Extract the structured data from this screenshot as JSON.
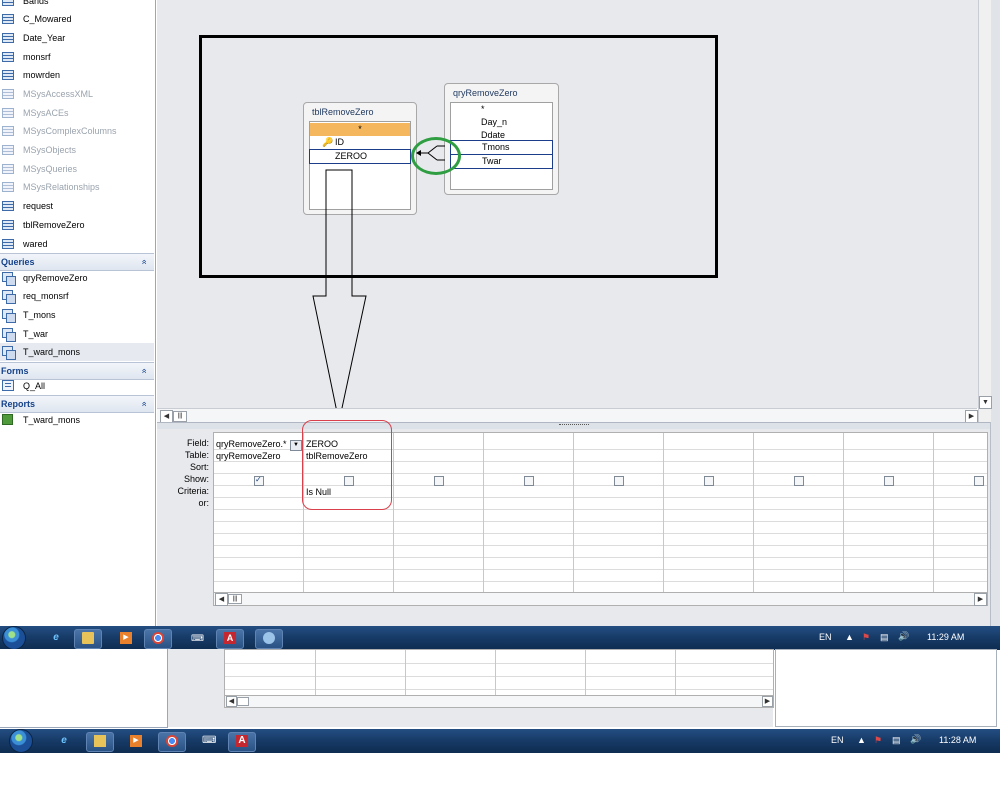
{
  "nav": {
    "tables": [
      "Bands",
      "C_Mowared",
      "Date_Year",
      "monsrf",
      "mowrden",
      "MSysAccessXML",
      "MSysACEs",
      "MSysComplexColumns",
      "MSysObjects",
      "MSysQueries",
      "MSysRelationships",
      "request",
      "tblRemoveZero",
      "wared"
    ],
    "queries_header": "Queries",
    "queries": [
      "qryRemoveZero",
      "req_monsrf",
      "T_mons",
      "T_war",
      "T_ward_mons"
    ],
    "forms_header": "Forms",
    "forms": [
      "Q_All"
    ],
    "reports_header": "Reports",
    "reports": [
      "T_ward_mons"
    ],
    "chevron": "»"
  },
  "tables": {
    "tblRemoveZero": {
      "title": "tblRemoveZero",
      "fields": [
        "*",
        "ID",
        "ZEROO"
      ]
    },
    "qryRemoveZero": {
      "title": "qryRemoveZero",
      "fields": [
        "*",
        "Day_n",
        "Ddate",
        "Tmons",
        "Twar"
      ]
    }
  },
  "grid": {
    "row_labels": [
      "Field:",
      "Table:",
      "Sort:",
      "Show:",
      "Criteria:",
      "or:"
    ],
    "col1": {
      "field": "qryRemoveZero.*",
      "table": "qryRemoveZero",
      "show": true
    },
    "col2": {
      "field": "ZEROO",
      "table": "tblRemoveZero",
      "show": false,
      "criteria": "Is Null"
    }
  },
  "taskbar1": {
    "lang": "EN",
    "time": "11:29 AM"
  },
  "taskbar2": {
    "lang": "EN",
    "time": "11:28 AM"
  },
  "colors": {
    "taskbar": "#1a4272",
    "highlight_red": "#d9404b",
    "highlight_green": "#2f9e42",
    "star_row": "#f5b75e"
  }
}
